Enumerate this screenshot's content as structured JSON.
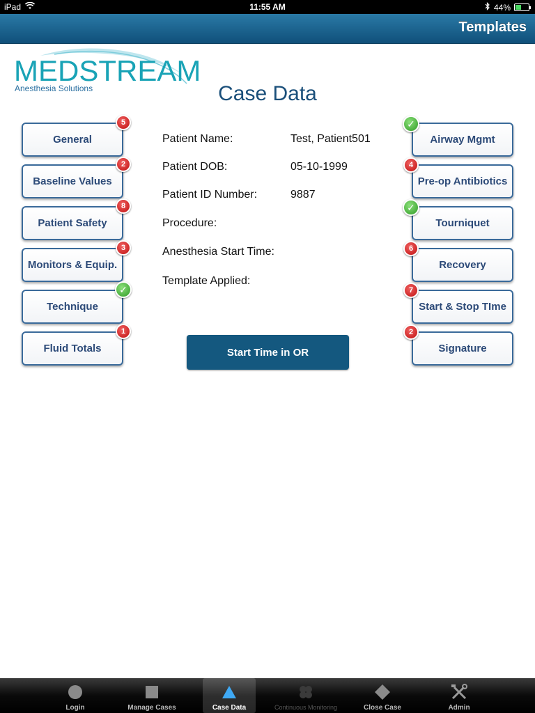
{
  "status_bar": {
    "device": "iPad",
    "time": "11:55 AM",
    "battery": "44%",
    "battery_level": 0.44
  },
  "nav": {
    "title": "Templates"
  },
  "logo": {
    "wordmark": "MEDSTREAM",
    "tagline": "Anesthesia Solutions"
  },
  "page_title": "Case Data",
  "left_buttons": [
    {
      "label": "General",
      "badge": "5",
      "status": "count"
    },
    {
      "label": "Baseline Values",
      "badge": "2",
      "status": "count"
    },
    {
      "label": "Patient Safety",
      "badge": "8",
      "status": "count"
    },
    {
      "label": "Monitors & Equip.",
      "badge": "3",
      "status": "count"
    },
    {
      "label": "Technique",
      "badge": "",
      "status": "complete"
    },
    {
      "label": "Fluid Totals",
      "badge": "1",
      "status": "count"
    }
  ],
  "right_buttons": [
    {
      "label": "Airway Mgmt",
      "badge": "",
      "status": "complete"
    },
    {
      "label": "Pre-op Antibiotics",
      "badge": "4",
      "status": "count"
    },
    {
      "label": "Tourniquet",
      "badge": "",
      "status": "complete"
    },
    {
      "label": "Recovery",
      "badge": "6",
      "status": "count"
    },
    {
      "label": "Start & Stop TIme",
      "badge": "7",
      "status": "count"
    },
    {
      "label": "Signature",
      "badge": "2",
      "status": "count"
    }
  ],
  "patient": {
    "name_label": "Patient Name:",
    "name": "Test, Patient501",
    "dob_label": "Patient DOB:",
    "dob": "05-10-1999",
    "id_label": "Patient ID Number:",
    "id": "9887",
    "procedure_label": "Procedure:",
    "procedure": "",
    "start_label": "Anesthesia Start Time:",
    "start": "",
    "template_label": "Template Applied:",
    "template": ""
  },
  "start_button": "Start Time in OR",
  "tabs": [
    {
      "label": "Login",
      "icon": "circle-icon",
      "state": "normal"
    },
    {
      "label": "Manage Cases",
      "icon": "square-icon",
      "state": "normal"
    },
    {
      "label": "Case Data",
      "icon": "triangle-icon",
      "state": "active"
    },
    {
      "label": "Continuous Monitoring",
      "icon": "clover-icon",
      "state": "disabled"
    },
    {
      "label": "Close Case",
      "icon": "diamond-icon",
      "state": "normal"
    },
    {
      "label": "Admin",
      "icon": "tools-icon",
      "state": "normal"
    }
  ],
  "colors": {
    "nav_blue": "#10507a",
    "button_text": "#2c4a78",
    "badge_red": "#c01010",
    "check_green": "#2f9a25",
    "title_blue": "#1a4f7a"
  }
}
